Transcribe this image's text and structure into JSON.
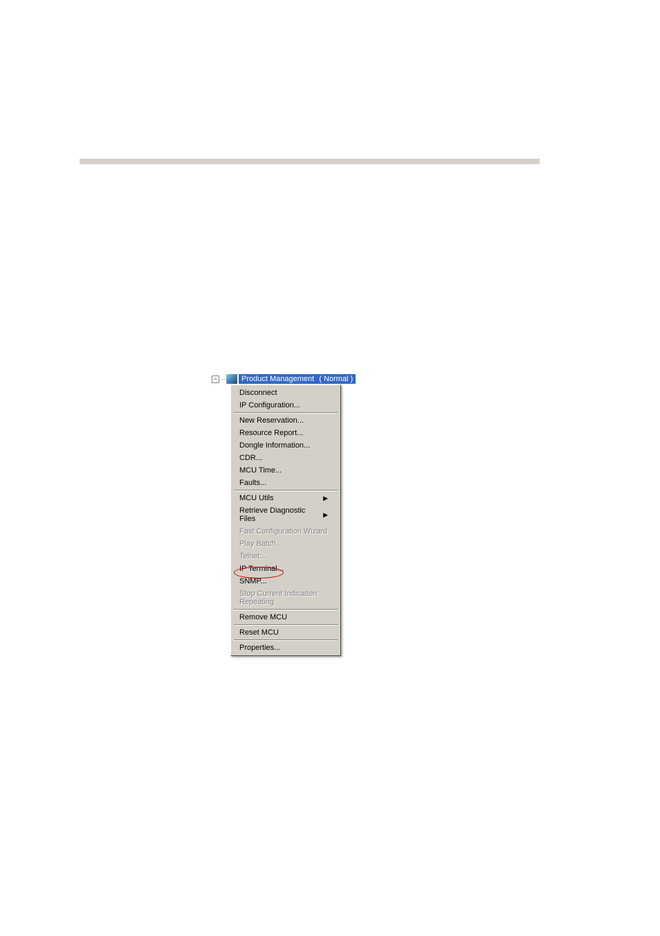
{
  "tree": {
    "expander": "−",
    "label": "Product Management",
    "status": "( Normal )"
  },
  "menu": {
    "disconnect": "Disconnect",
    "ip_configuration": "IP Configuration...",
    "new_reservation": "New Reservation...",
    "resource_report": "Resource Report...",
    "dongle_information": "Dongle Information...",
    "cdr": "CDR...",
    "mcu_time": "MCU Time...",
    "faults": "Faults...",
    "mcu_utils": "MCU Utils",
    "retrieve_diagnostic": "Retrieve Diagnostic Files",
    "fast_config_wizard": "Fast Configuration Wizard",
    "play_batch": "Play Batch...",
    "telnet": "Telnet...",
    "ip_terminal": "IP Terminal...",
    "snmp": "SNMP...",
    "stop_indication": "Stop Current Indication Repeating",
    "remove_mcu": "Remove MCU",
    "reset_mcu": "Reset MCU",
    "properties": "Properties..."
  }
}
